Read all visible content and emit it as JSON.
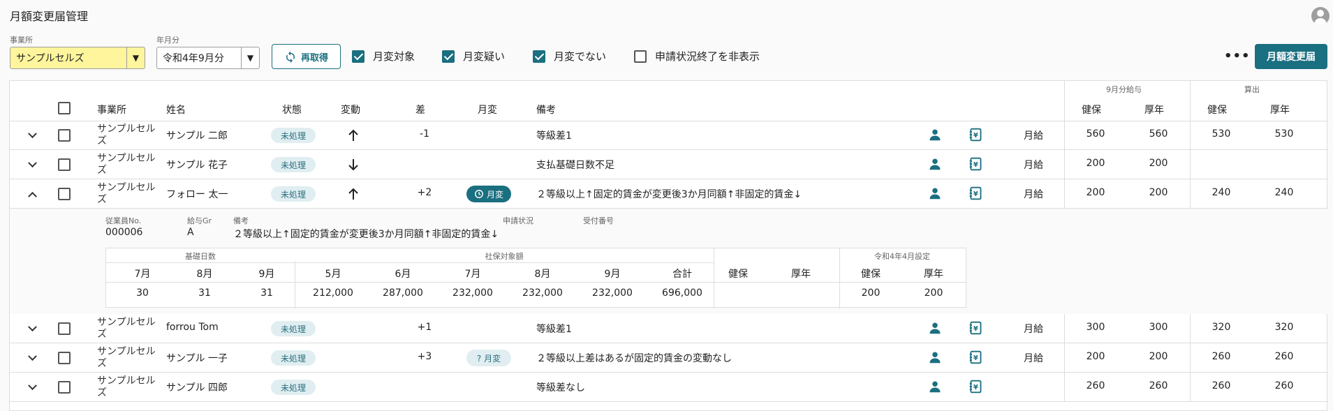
{
  "page": {
    "title": "月額変更届管理"
  },
  "filters": {
    "office_label": "事業所",
    "office_value": "サンプルセルズ",
    "month_label": "年月分",
    "month_value": "令和4年9月分",
    "refresh_label": "再取得",
    "checks": [
      {
        "label": "月変対象",
        "checked": true
      },
      {
        "label": "月変疑い",
        "checked": true
      },
      {
        "label": "月変でない",
        "checked": true
      },
      {
        "label": "申請状況終了を非表示",
        "checked": false
      }
    ],
    "more_label": "•••",
    "submit_label": "月額変更届"
  },
  "table": {
    "headers": {
      "office": "事業所",
      "name": "姓名",
      "status": "状態",
      "change": "変動",
      "diff": "差",
      "getsuhen": "月変",
      "note": "備考",
      "salary_group": "9月分給与",
      "calc_group": "算出",
      "kenpo": "健保",
      "kounen": "厚年"
    },
    "rows": [
      {
        "office": "サンプルセルズ",
        "name": "サンプル 二郎",
        "status": "未処理",
        "change": "up",
        "diff": "-1",
        "getsuhen": "",
        "note": "等級差1",
        "pay": "月給",
        "s_k": "560",
        "s_n": "560",
        "c_k": "530",
        "c_n": "530",
        "expanded": false
      },
      {
        "office": "サンプルセルズ",
        "name": "サンプル 花子",
        "status": "未処理",
        "change": "down",
        "diff": "",
        "getsuhen": "",
        "note": "支払基礎日数不足",
        "pay": "月給",
        "s_k": "200",
        "s_n": "200",
        "c_k": "",
        "c_n": "",
        "expanded": false
      },
      {
        "office": "サンプルセルズ",
        "name": "フォロー 太一",
        "status": "未処理",
        "change": "up",
        "diff": "+2",
        "getsuhen": "月変",
        "note": "２等級以上↑固定的賃金が変更後3か月同額↑非固定的賃金↓",
        "pay": "月給",
        "s_k": "200",
        "s_n": "200",
        "c_k": "240",
        "c_n": "240",
        "expanded": true
      },
      {
        "office": "サンプルセルズ",
        "name": "forrou Tom",
        "status": "未処理",
        "change": "",
        "diff": "+1",
        "getsuhen": "",
        "note": "等級差1",
        "pay": "月給",
        "s_k": "300",
        "s_n": "300",
        "c_k": "320",
        "c_n": "320",
        "expanded": false
      },
      {
        "office": "サンプルセルズ",
        "name": "サンプル 一子",
        "status": "未処理",
        "change": "",
        "diff": "+3",
        "getsuhen": "? 月変",
        "note": "２等級以上差はあるが固定的賃金の変動なし",
        "pay": "月給",
        "s_k": "200",
        "s_n": "200",
        "c_k": "260",
        "c_n": "260",
        "expanded": false
      },
      {
        "office": "サンプルセルズ",
        "name": "サンプル 四郎",
        "status": "未処理",
        "change": "",
        "diff": "",
        "getsuhen": "",
        "note": "等級差なし",
        "pay": "",
        "s_k": "260",
        "s_n": "260",
        "c_k": "260",
        "c_n": "260",
        "expanded": false
      }
    ]
  },
  "detail": {
    "emp_no_label": "従業員No.",
    "emp_no": "000006",
    "grade_label": "給与Gr",
    "grade": "A",
    "note_label": "備考",
    "note": "２等級以上↑固定的賃金が変更後3か月同額↑非固定的賃金↓",
    "apply_label": "申請状況",
    "receipt_label": "受付番号",
    "days_group": "基礎日数",
    "days_months": [
      "7月",
      "8月",
      "9月"
    ],
    "days_values": [
      "30",
      "31",
      "31"
    ],
    "pay_group": "社保対象額",
    "pay_months": [
      "5月",
      "6月",
      "7月",
      "8月",
      "9月",
      "合計"
    ],
    "pay_values": [
      "212,000",
      "287,000",
      "232,000",
      "232,000",
      "232,000",
      "696,000"
    ],
    "kenpo": "健保",
    "kounen": "厚年",
    "r4_group": "令和4年4月設定",
    "r4_values": [
      "200",
      "200"
    ]
  },
  "colors": {
    "accent": "#1a6f80",
    "badge_bg": "#e0eef1",
    "highlight": "#fff59d"
  }
}
